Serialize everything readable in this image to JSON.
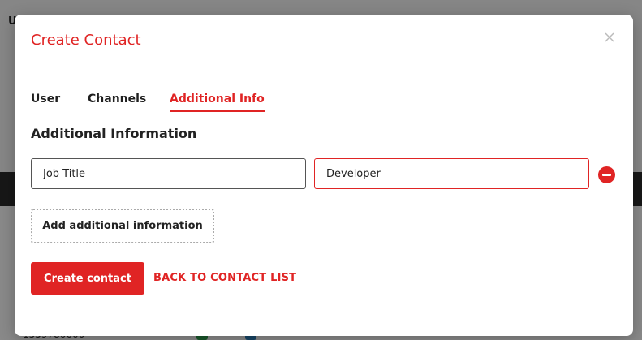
{
  "background": {
    "top_initial": "U",
    "phone_partial": "1559780000"
  },
  "modal": {
    "title": "Create Contact",
    "close_icon": "close-icon",
    "tabs": [
      {
        "label": "User",
        "active": false
      },
      {
        "label": "Channels",
        "active": false
      },
      {
        "label": "Additional Info",
        "active": true
      }
    ],
    "section_title": "Additional Information",
    "fields": [
      {
        "value": "Job Title"
      },
      {
        "value": "Developer"
      }
    ],
    "remove_icon": "minus-circle-icon",
    "add_button_label": "Add additional information",
    "create_button_label": "Create contact",
    "back_link_label": "BACK TO CONTACT LIST"
  },
  "colors": {
    "accent": "#e02424",
    "overlay": "rgba(0,0,0,0.45)"
  }
}
